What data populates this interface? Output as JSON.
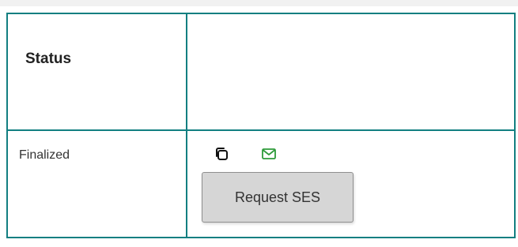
{
  "table": {
    "header": {
      "status_label": "Status"
    },
    "row": {
      "status_value": "Finalized",
      "actions": {
        "copy_icon": "copy-icon",
        "email_icon": "envelope-icon",
        "request_button_label": "Request SES"
      }
    }
  },
  "colors": {
    "border": "#127f81",
    "email_icon": "#2e9b3a",
    "button_bg": "#d6d6d6"
  }
}
